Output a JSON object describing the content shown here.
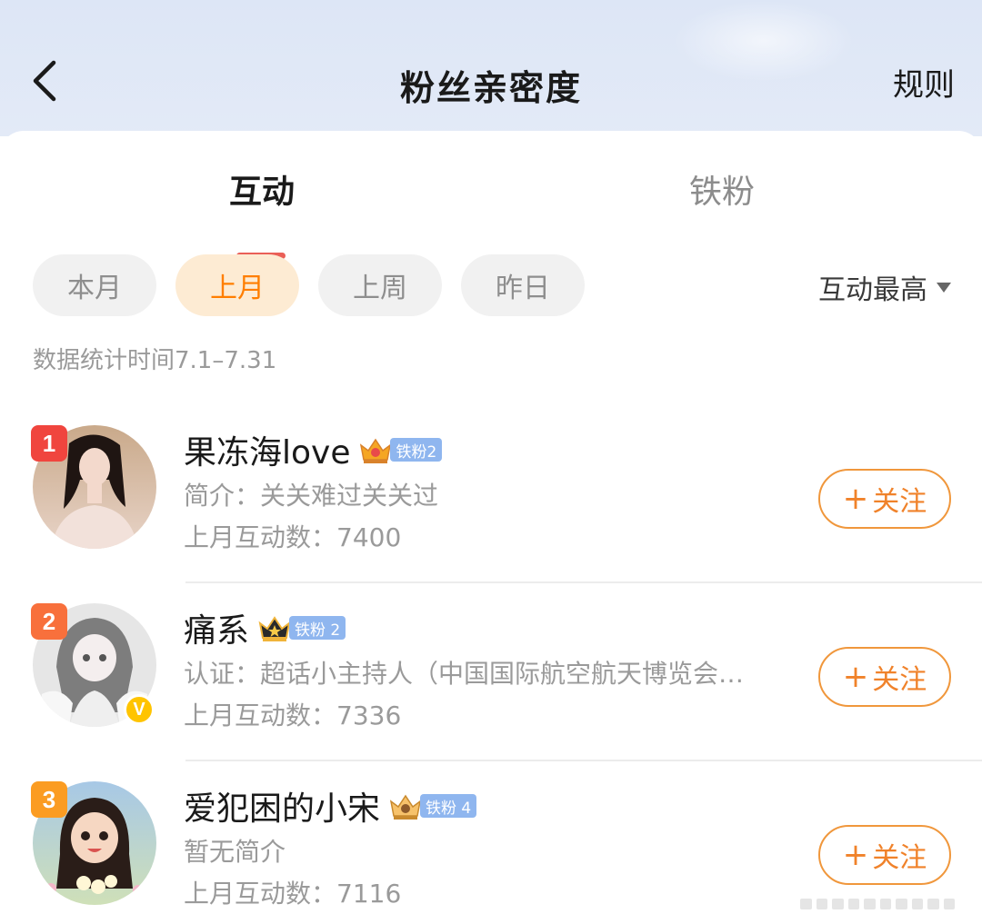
{
  "header": {
    "title": "粉丝亲密度",
    "rules_label": "规则"
  },
  "tabs": [
    {
      "label": "互动",
      "active": true
    },
    {
      "label": "铁粉",
      "active": false
    }
  ],
  "filters": {
    "chips": [
      {
        "label": "本月",
        "active": false
      },
      {
        "label": "上月",
        "active": true
      },
      {
        "label": "上周",
        "active": false
      },
      {
        "label": "昨日",
        "active": false
      }
    ],
    "sort_label": "互动最高",
    "date_range": "数据统计时间7.1–7.31"
  },
  "fans": [
    {
      "rank": "1",
      "name": "果冻海love",
      "level_tag": "铁粉2",
      "desc": "简介：关关难过关关过",
      "count": "上月互动数：7400",
      "follow_label": "关注",
      "verified": false
    },
    {
      "rank": "2",
      "name": "痛系",
      "level_tag": "铁粉 2",
      "desc": "认证：超话小主持人（中国国际航空航天博览会…",
      "count": "上月互动数：7336",
      "follow_label": "关注",
      "verified": true
    },
    {
      "rank": "3",
      "name": "爱犯困的小宋",
      "level_tag": "铁粉 4",
      "desc": "暂无简介",
      "count": "上月互动数：7116",
      "follow_label": "关注",
      "verified": false
    }
  ],
  "colors": {
    "accent_orange": "#ff7e00",
    "tab_underline": "#ea5f57",
    "level_tag_blue": "#8fb6ef",
    "rank_1": "#f0453e",
    "rank_2": "#f8703c",
    "rank_3": "#fb9c22"
  },
  "icons": {
    "back": "chevron-left-icon",
    "sort": "caret-down-icon",
    "crown": "crown-icon",
    "verified": "verified-v-icon",
    "follow": "plus-icon"
  }
}
